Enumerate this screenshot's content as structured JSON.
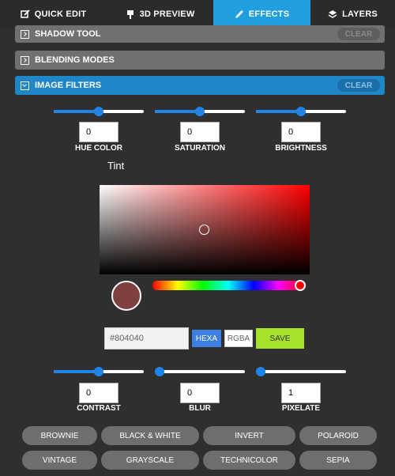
{
  "tabs": [
    {
      "label": "QUICK EDIT",
      "icon": "edit-icon"
    },
    {
      "label": "3D PREVIEW",
      "icon": "pin-icon"
    },
    {
      "label": "EFFECTS",
      "icon": "pencil-icon",
      "active": true
    },
    {
      "label": "LAYERS",
      "icon": "layers-icon"
    }
  ],
  "sections": {
    "shadow": {
      "label": "SHADOW TOOL",
      "clear": "CLEAR"
    },
    "blending": {
      "label": "BLENDING MODES"
    },
    "filters": {
      "label": "IMAGE FILTERS",
      "clear": "CLEAR"
    }
  },
  "filters_row1": [
    {
      "label": "HUE COLOR",
      "value": "0",
      "level_pct": 50
    },
    {
      "label": "SATURATION",
      "value": "0",
      "level_pct": 50
    },
    {
      "label": "BRIGHTNESS",
      "value": "0",
      "level_pct": 50
    }
  ],
  "tint": {
    "label": "Tint",
    "hex_value": "#804040",
    "swatch_color": "#804040",
    "hex_button": "HEXA",
    "rgba_button": "RGBA",
    "save_button": "SAVE"
  },
  "filters_row2": [
    {
      "label": "CONTRAST",
      "value": "0",
      "level_pct": 50
    },
    {
      "label": "BLUR",
      "value": "0",
      "level_pct": 0
    },
    {
      "label": "PIXELATE",
      "value": "1",
      "level_pct": 0
    }
  ],
  "presets": [
    "BROWNIE",
    "BLACK & WHITE",
    "INVERT",
    "POLAROID",
    "VINTAGE",
    "GRAYSCALE",
    "TECHNICOLOR",
    "SEPIA"
  ],
  "colors": {
    "accent": "#1f9ee0",
    "save": "#a6e22e",
    "panel": "#2f2f2f"
  }
}
